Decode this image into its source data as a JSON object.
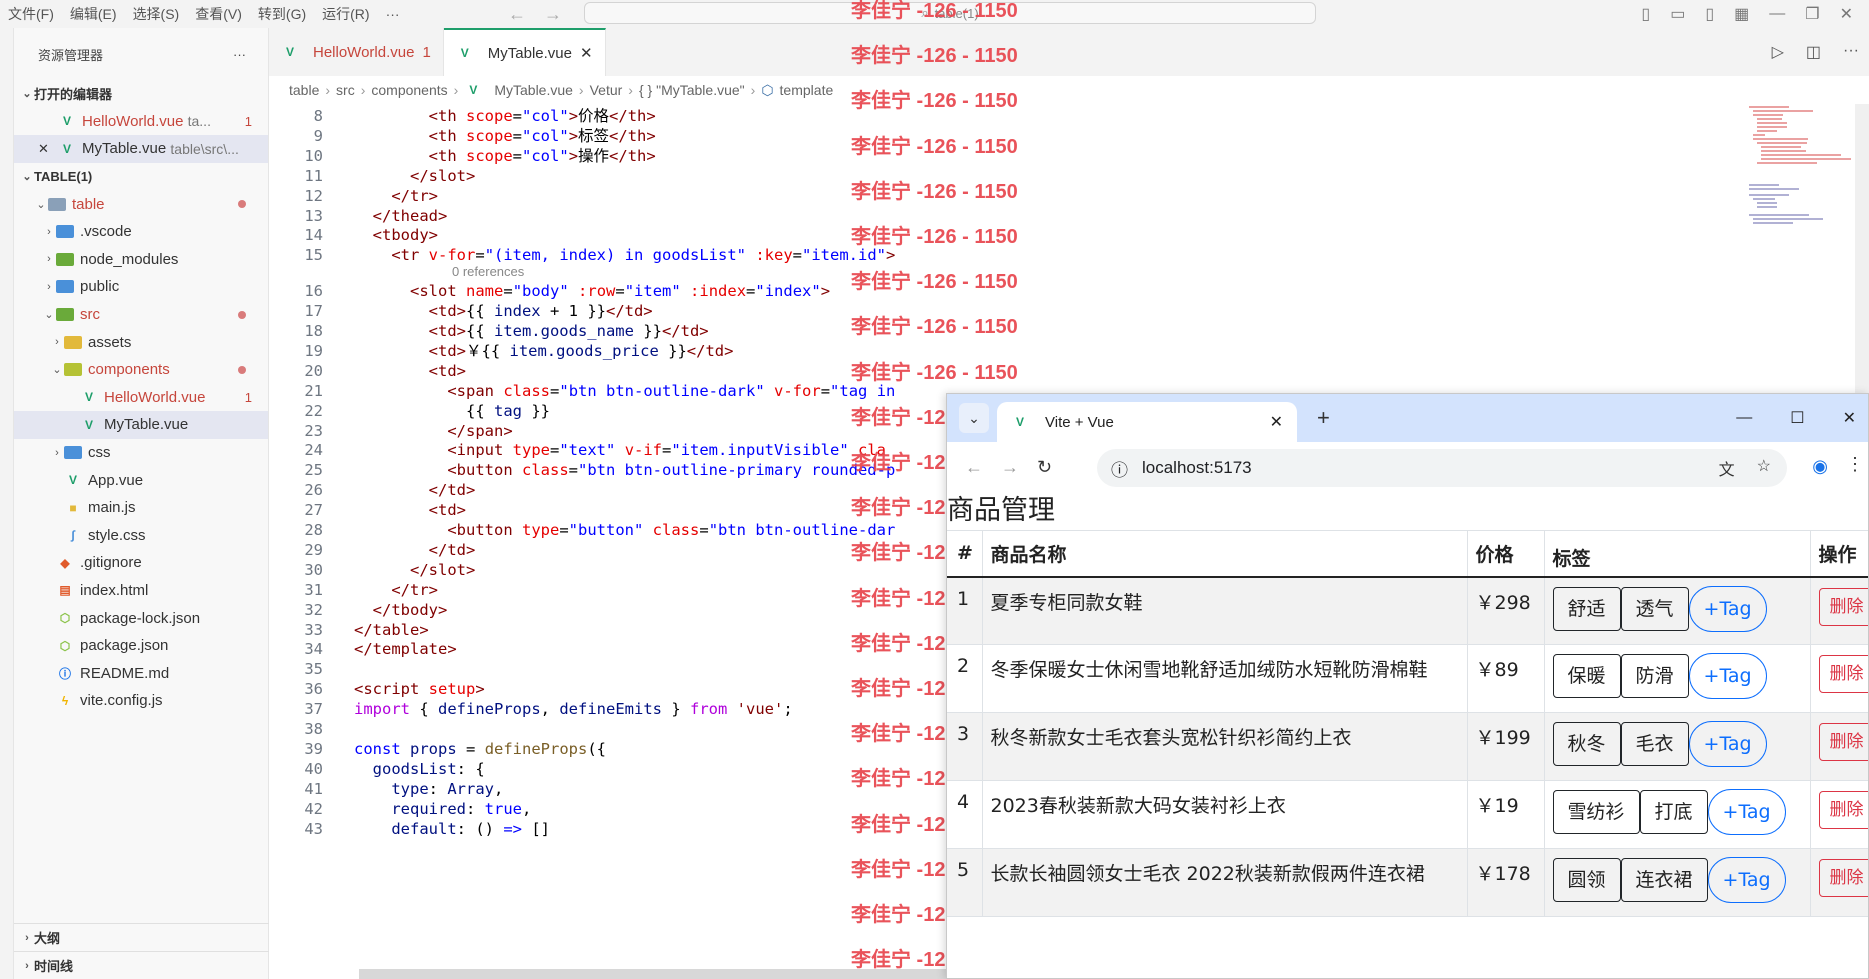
{
  "menu": [
    "文件(F)",
    "编辑(E)",
    "选择(S)",
    "查看(V)",
    "转到(G)",
    "运行(R)",
    "···"
  ],
  "command_center": {
    "text": "table(1)"
  },
  "sidebar": {
    "title": "资源管理器",
    "more": "···",
    "open_editors_label": "打开的编辑器",
    "open_editors": [
      {
        "name": "HelloWorld.vue",
        "path": "ta...",
        "badge": "1"
      },
      {
        "name": "MyTable.vue",
        "path": "table\\src\\..."
      }
    ],
    "workspace_label": "TABLE(1)",
    "tree": [
      {
        "label": "table"
      },
      {
        "label": ".vscode"
      },
      {
        "label": "node_modules"
      },
      {
        "label": "public"
      },
      {
        "label": "src"
      },
      {
        "label": "assets"
      },
      {
        "label": "components"
      },
      {
        "label": "HelloWorld.vue",
        "badge": "1"
      },
      {
        "label": "MyTable.vue"
      },
      {
        "label": "css"
      },
      {
        "label": "App.vue"
      },
      {
        "label": "main.js"
      },
      {
        "label": "style.css"
      },
      {
        "label": ".gitignore"
      },
      {
        "label": "index.html"
      },
      {
        "label": "package-lock.json"
      },
      {
        "label": "package.json"
      },
      {
        "label": "README.md"
      },
      {
        "label": "vite.config.js"
      }
    ],
    "outline_label": "大纲",
    "timeline_label": "时间线"
  },
  "tabs": [
    {
      "label": "HelloWorld.vue",
      "badge": "1"
    },
    {
      "label": "MyTable.vue",
      "close": "✕"
    }
  ],
  "breadcrumb": [
    "table",
    "src",
    "components",
    "MyTable.vue",
    "Vetur",
    "{ } \"MyTable.vue\"",
    "template"
  ],
  "code_lines": [
    {
      "n": "8",
      "html": "        <span class='t-tag'>&lt;th</span> <span class='t-attr'>scope</span>=<span class='t-str'>\"col\"</span><span class='t-tag'>&gt;</span>价格<span class='t-tag'>&lt;/th&gt;</span>"
    },
    {
      "n": "9",
      "html": "        <span class='t-tag'>&lt;th</span> <span class='t-attr'>scope</span>=<span class='t-str'>\"col\"</span><span class='t-tag'>&gt;</span>标签<span class='t-tag'>&lt;/th&gt;</span>"
    },
    {
      "n": "10",
      "html": "        <span class='t-tag'>&lt;th</span> <span class='t-attr'>scope</span>=<span class='t-str'>\"col\"</span><span class='t-tag'>&gt;</span>操作<span class='t-tag'>&lt;/th&gt;</span>"
    },
    {
      "n": "11",
      "html": "      <span class='t-tag'>&lt;/slot&gt;</span>"
    },
    {
      "n": "12",
      "html": "    <span class='t-tag'>&lt;/tr&gt;</span>"
    },
    {
      "n": "13",
      "html": "  <span class='t-tag'>&lt;/thead&gt;</span>"
    },
    {
      "n": "14",
      "html": "  <span class='t-tag'>&lt;tbody&gt;</span>"
    },
    {
      "n": "15",
      "html": "    <span class='t-tag'>&lt;tr</span> <span class='t-attr'>v-for</span>=<span class='t-str'>\"(item, index) in goodsList\"</span> <span class='t-attr'>:key</span>=<span class='t-str'>\"item.id\"</span><span class='t-tag'>&gt;</span>"
    },
    {
      "n": "16",
      "html": "      <span class='t-tag'>&lt;slot</span> <span class='t-attr'>name</span>=<span class='t-str'>\"body\"</span> <span class='t-attr'>:row</span>=<span class='t-str'>\"item\"</span> <span class='t-attr'>:index</span>=<span class='t-str'>\"index\"</span><span class='t-tag'>&gt;</span>"
    },
    {
      "n": "17",
      "html": "        <span class='t-tag'>&lt;td&gt;</span>{{ <span class='t-var'>index</span> + 1 }}<span class='t-tag'>&lt;/td&gt;</span>"
    },
    {
      "n": "18",
      "html": "        <span class='t-tag'>&lt;td&gt;</span>{{ <span class='t-var'>item.goods_name</span> }}<span class='t-tag'>&lt;/td&gt;</span>"
    },
    {
      "n": "19",
      "html": "        <span class='t-tag'>&lt;td&gt;</span>￥{{ <span class='t-var'>item.goods_price</span> }}<span class='t-tag'>&lt;/td&gt;</span>"
    },
    {
      "n": "20",
      "html": "        <span class='t-tag'>&lt;td&gt;</span>"
    },
    {
      "n": "21",
      "html": "          <span class='t-tag'>&lt;span</span> <span class='t-attr'>class</span>=<span class='t-str'>\"btn btn-outline-dark\"</span> <span class='t-attr'>v-for</span>=<span class='t-str'>\"tag in</span>"
    },
    {
      "n": "22",
      "html": "            {{ <span class='t-var'>tag</span> }}"
    },
    {
      "n": "23",
      "html": "          <span class='t-tag'>&lt;/span&gt;</span>"
    },
    {
      "n": "24",
      "html": "          <span class='t-tag'>&lt;input</span> <span class='t-attr'>type</span>=<span class='t-str'>\"text\"</span> <span class='t-attr'>v-if</span>=<span class='t-str'>\"item.inputVisible\"</span> <span class='t-attr'>cla</span>"
    },
    {
      "n": "25",
      "html": "          <span class='t-tag'>&lt;button</span> <span class='t-attr'>class</span>=<span class='t-str'>\"btn btn-outline-primary rounded-p</span>"
    },
    {
      "n": "26",
      "html": "        <span class='t-tag'>&lt;/td&gt;</span>"
    },
    {
      "n": "27",
      "html": "        <span class='t-tag'>&lt;td&gt;</span>"
    },
    {
      "n": "28",
      "html": "          <span class='t-tag'>&lt;button</span> <span class='t-attr'>type</span>=<span class='t-str'>\"button\"</span> <span class='t-attr'>class</span>=<span class='t-str'>\"btn btn-outline-dar</span>"
    },
    {
      "n": "29",
      "html": "        <span class='t-tag'>&lt;/td&gt;</span>"
    },
    {
      "n": "30",
      "html": "      <span class='t-tag'>&lt;/slot&gt;</span>"
    },
    {
      "n": "31",
      "html": "    <span class='t-tag'>&lt;/tr&gt;</span>"
    },
    {
      "n": "32",
      "html": "  <span class='t-tag'>&lt;/tbody&gt;</span>"
    },
    {
      "n": "33",
      "html": "<span class='t-tag'>&lt;/table&gt;</span>"
    },
    {
      "n": "34",
      "html": "<span class='t-tag'>&lt;/template&gt;</span>"
    },
    {
      "n": "35",
      "html": ""
    },
    {
      "n": "36",
      "html": "<span class='t-tag'>&lt;script</span> <span class='t-attr'>setup</span><span class='t-tag'>&gt;</span>"
    },
    {
      "n": "37",
      "html": "<span class='t-ctl'>import</span> { <span class='t-var'>defineProps</span>, <span class='t-var'>defineEmits</span> } <span class='t-ctl'>from</span> <span class='t-tag'>'vue'</span>;"
    },
    {
      "n": "38",
      "html": ""
    },
    {
      "n": "39",
      "html": "<span class='t-kw'>const</span> <span class='t-var'>props</span> = <span class='t-fn'>defineProps</span>({"
    },
    {
      "n": "40",
      "html": "  <span class='t-var'>goodsList</span>: {"
    },
    {
      "n": "41",
      "html": "    <span class='t-var'>type</span>: <span class='t-var'>Array</span>,"
    },
    {
      "n": "42",
      "html": "    <span class='t-var'>required</span>: <span class='t-kw'>true</span>,"
    },
    {
      "n": "43",
      "html": "    <span class='t-var'>default</span>: () <span class='t-kw'>=&gt;</span> []"
    }
  ],
  "code_lens": "0 references",
  "watermark": "李佳宁 -126 - 1150",
  "browser": {
    "tab_title": "Vite + Vue",
    "tab_close": "✕",
    "new_tab": "+",
    "url": "localhost:5173",
    "page_title": "商品管理",
    "columns": [
      "#",
      "商品名称",
      "价格",
      "标签",
      "操作"
    ],
    "add_tag_label": "+Tag",
    "delete_label": "删除",
    "rows": [
      {
        "index": "1",
        "name": "夏季专柜同款女鞋",
        "price": "￥298",
        "tags": [
          "舒适",
          "透气"
        ]
      },
      {
        "index": "2",
        "name": "冬季保暖女士休闲雪地靴舒适加绒防水短靴防滑棉鞋",
        "price": "￥89",
        "tags": [
          "保暖",
          "防滑"
        ]
      },
      {
        "index": "3",
        "name": "秋冬新款女士毛衣套头宽松针织衫简约上衣",
        "price": "￥199",
        "tags": [
          "秋冬",
          "毛衣"
        ]
      },
      {
        "index": "4",
        "name": "2023春秋装新款大码女装衬衫上衣",
        "price": "￥19",
        "tags": [
          "雪纺衫",
          "打底"
        ]
      },
      {
        "index": "5",
        "name": "长款长袖圆领女士毛衣 2022秋装新款假两件连衣裙",
        "price": "￥178",
        "tags": [
          "圆领",
          "连衣裙"
        ]
      }
    ]
  }
}
